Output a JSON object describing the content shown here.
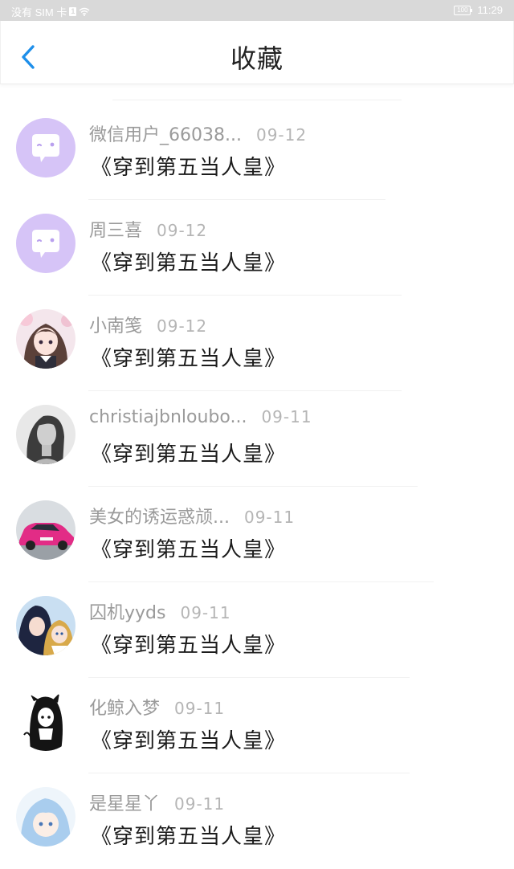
{
  "status_bar": {
    "carrier": "没有 SIM 卡",
    "sim_badge": "1",
    "battery": "100",
    "time": "11:29"
  },
  "header": {
    "title": "收藏"
  },
  "favorites": [
    {
      "name": "微信用户_66038...",
      "date": "09-12",
      "content": "《穿到第五当人皇》"
    },
    {
      "name": "周三喜",
      "date": "09-12",
      "content": "《穿到第五当人皇》"
    },
    {
      "name": "小南笺",
      "date": "09-12",
      "content": "《穿到第五当人皇》"
    },
    {
      "name": "christiajbnloubo...",
      "date": "09-11",
      "content": "《穿到第五当人皇》"
    },
    {
      "name": "美女的诱运惑颃...",
      "date": "09-11",
      "content": "《穿到第五当人皇》"
    },
    {
      "name": "囚机yyds",
      "date": "09-11",
      "content": "《穿到第五当人皇》"
    },
    {
      "name": "化鲸入梦",
      "date": "09-11",
      "content": "《穿到第五当人皇》"
    },
    {
      "name": "是星星丫",
      "date": "09-11",
      "content": "《穿到第五当人皇》"
    }
  ]
}
